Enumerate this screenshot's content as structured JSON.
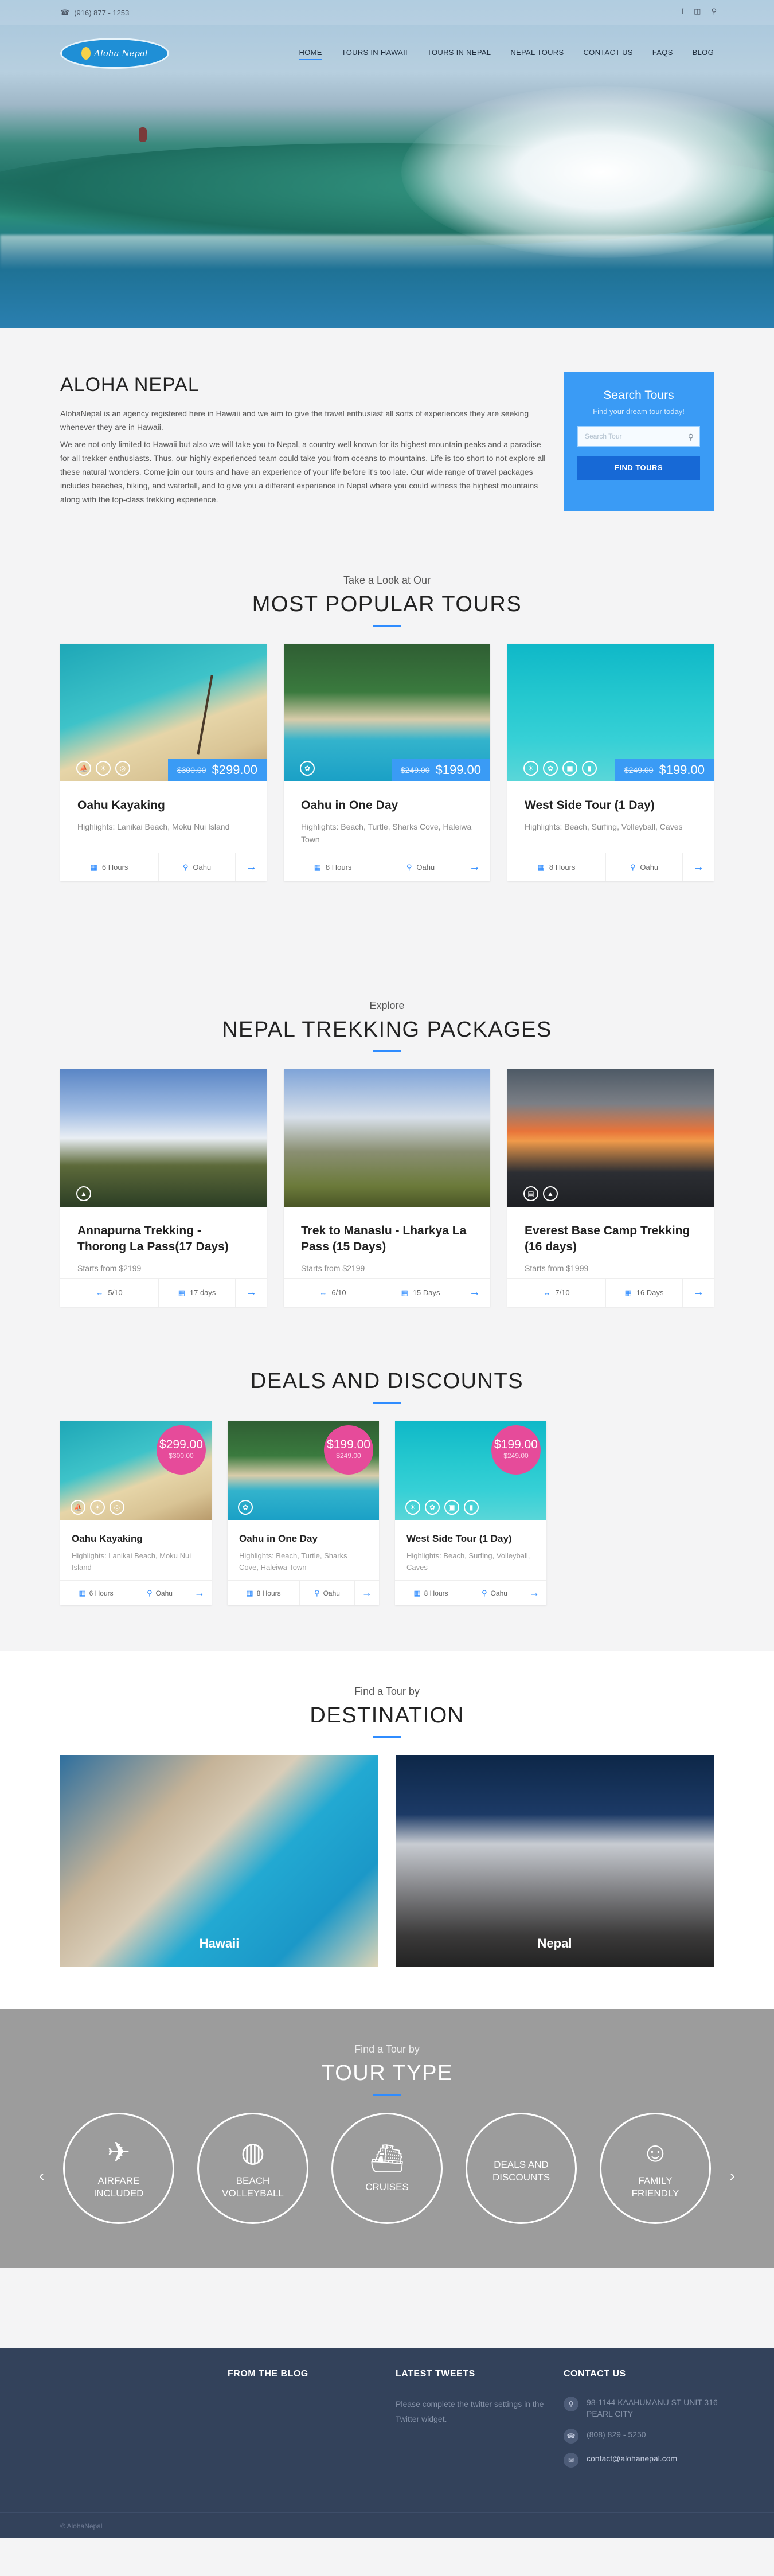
{
  "topbar": {
    "phone": "(916) 877 - 1253",
    "social": [
      "f",
      "instagram-icon",
      "search-icon"
    ]
  },
  "brand": {
    "logo_text": "Aloha Nepal"
  },
  "nav": [
    {
      "label": "HOME",
      "active": true
    },
    {
      "label": "TOURS IN HAWAII"
    },
    {
      "label": "TOURS IN NEPAL"
    },
    {
      "label": "NEPAL TOURS"
    },
    {
      "label": "CONTACT US"
    },
    {
      "label": "FAQS"
    },
    {
      "label": "BLOG"
    }
  ],
  "intro": {
    "title": "ALOHA NEPAL",
    "p1": "AlohaNepal is an agency registered here in Hawaii and we aim to give the travel enthusiast all sorts of experiences they are seeking whenever they are in Hawaii.",
    "p2": "We are not only limited to Hawaii but also we will take you to Nepal, a country well known for its highest mountain peaks and a paradise for all trekker enthusiasts. Thus, our highly experienced team could take you from oceans to mountains. Life is too short to not explore all these natural wonders. Come join our tours and have an experience of your life before it's too late. Our wide range of travel packages includes beaches, biking, and waterfall, and to give you a different experience in Nepal where you could witness the highest mountains along with the top-class trekking experience."
  },
  "search": {
    "title": "Search Tours",
    "subtitle": "Find your dream tour today!",
    "placeholder": "Search Tour",
    "button": "FIND TOURS"
  },
  "popular": {
    "pre": "Take a Look at Our",
    "title": "MOST POPULAR TOURS",
    "tours": [
      {
        "title": "Oahu Kayaking",
        "highlights": "Highlights: Lanikai Beach, Moku Nui Island",
        "old_price": "$300.00",
        "price": "$299.00",
        "duration": "6 Hours",
        "location": "Oahu"
      },
      {
        "title": "Oahu in One Day",
        "highlights": "Highlights: Beach, Turtle, Sharks Cove, Haleiwa Town",
        "old_price": "$249.00",
        "price": "$199.00",
        "duration": "8 Hours",
        "location": "Oahu"
      },
      {
        "title": "West Side Tour (1 Day)",
        "highlights": "Highlights: Beach, Surfing, Volleyball, Caves",
        "old_price": "$249.00",
        "price": "$199.00",
        "duration": "8 Hours",
        "location": "Oahu"
      }
    ]
  },
  "nepal": {
    "pre": "Explore",
    "title": "NEPAL TREKKING PACKAGES",
    "packages": [
      {
        "title": "Annapurna Trekking - Thorong La Pass(17 Days)",
        "price": "Starts from $2199",
        "rating": "5/10",
        "duration": "17 days"
      },
      {
        "title": "Trek to Manaslu - Lharkya La Pass (15 Days)",
        "price": "Starts from $2199",
        "rating": "6/10",
        "duration": "15 Days"
      },
      {
        "title": "Everest Base Camp Trekking (16 days)",
        "price": "Starts from $1999",
        "rating": "7/10",
        "duration": "16 Days"
      }
    ]
  },
  "deals": {
    "title": "DEALS AND DISCOUNTS",
    "items": [
      {
        "title": "Oahu Kayaking",
        "highlights": "Highlights: Lanikai Beach, Moku Nui Island",
        "old_price": "$300.00",
        "price": "$299.00",
        "duration": "6 Hours",
        "location": "Oahu"
      },
      {
        "title": "Oahu in One Day",
        "highlights": "Highlights: Beach, Turtle, Sharks Cove, Haleiwa Town",
        "old_price": "$249.00",
        "price": "$199.00",
        "duration": "8 Hours",
        "location": "Oahu"
      },
      {
        "title": "West Side Tour (1 Day)",
        "highlights": "Highlights: Beach, Surfing, Volleyball, Caves",
        "old_price": "$249.00",
        "price": "$199.00",
        "duration": "8 Hours",
        "location": "Oahu"
      }
    ]
  },
  "destination": {
    "pre": "Find a Tour by",
    "title": "DESTINATION",
    "items": [
      "Hawaii",
      "Nepal"
    ]
  },
  "tour_type": {
    "pre": "Find a Tour by",
    "title": "TOUR TYPE",
    "items": [
      {
        "label": "AIRFARE INCLUDED",
        "icon": "airplane-icon"
      },
      {
        "label": "BEACH VOLLEYBALL",
        "icon": "volleyball-icon"
      },
      {
        "label": "CRUISES",
        "icon": "ship-icon"
      },
      {
        "label": "DEALS AND DISCOUNTS",
        "icon": "tag-icon"
      },
      {
        "label": "FAMILY FRIENDLY",
        "icon": "family-icon"
      }
    ]
  },
  "footer": {
    "blog_title": "FROM THE BLOG",
    "tweets_title": "LATEST TWEETS",
    "tweets_text": "Please complete the twitter settings in the Twitter widget.",
    "contact_title": "CONTACT US",
    "address": "98-1144 KAAHUMANU ST UNIT 316 PEARL CITY",
    "phone": "(808) 829 - 5250",
    "email": "contact@alohanepal.com",
    "copyright": "© AlohaNepal"
  },
  "colors": {
    "accent": "#3a9bf5",
    "deal_badge": "#e64b9a",
    "footer_bg": "#33425b"
  }
}
